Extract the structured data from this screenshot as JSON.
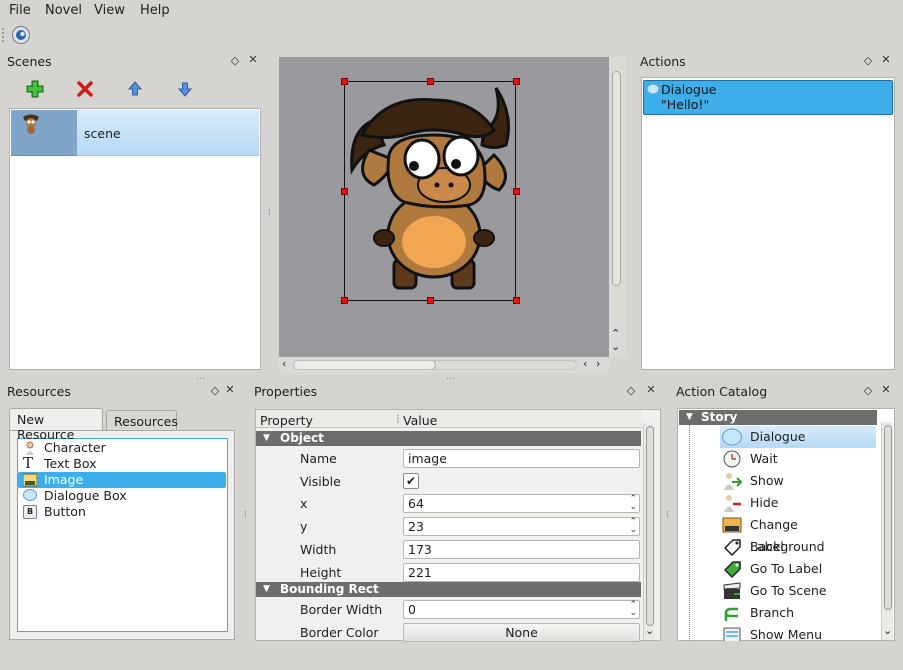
{
  "menu": [
    "File",
    "Novel",
    "View",
    "Help"
  ],
  "scenes_panel": {
    "title": "Scenes",
    "items": [
      {
        "label": "scene"
      }
    ]
  },
  "actions_panel": {
    "title": "Actions",
    "items": [
      {
        "name": "Dialogue",
        "text": "\"Hello!\""
      }
    ]
  },
  "resources_panel": {
    "title": "Resources",
    "tabs": [
      "New Resource",
      "Resources"
    ],
    "items": [
      "Character",
      "Text Box",
      "Image",
      "Dialogue Box",
      "Button"
    ],
    "selected": "Image"
  },
  "properties_panel": {
    "title": "Properties",
    "headers": {
      "property": "Property",
      "value": "Value"
    },
    "sections": {
      "object": "Object",
      "bounding": "Bounding Rect"
    },
    "rows": {
      "name": {
        "label": "Name",
        "value": "image"
      },
      "visible": {
        "label": "Visible",
        "value": "✔"
      },
      "x": {
        "label": "x",
        "value": "64"
      },
      "y": {
        "label": "y",
        "value": "23"
      },
      "width": {
        "label": "Width",
        "value": "173"
      },
      "height": {
        "label": "Height",
        "value": "221"
      },
      "border_width": {
        "label": "Border Width",
        "value": "0"
      },
      "border_color": {
        "label": "Border Color",
        "value": "None"
      }
    }
  },
  "catalog_panel": {
    "title": "Action Catalog",
    "group": "Story",
    "items": [
      "Dialogue",
      "Wait",
      "Show",
      "Hide",
      "Change Background",
      "Label",
      "Go To Label",
      "Go To Scene",
      "Branch",
      "Show Menu"
    ]
  },
  "colors": {
    "selection": "#3daee9",
    "window": "#d6d4d1",
    "section": "#6f6d6b"
  }
}
